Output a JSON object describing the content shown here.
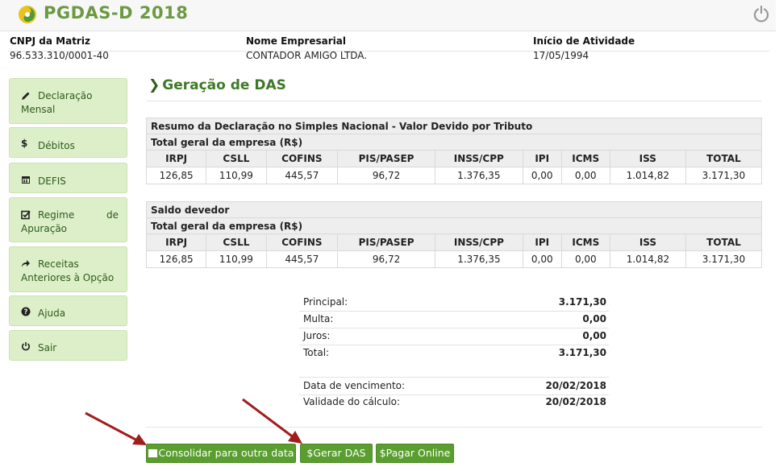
{
  "header": {
    "app_title": "PGDAS-D 2018",
    "logo_icon": "pgdas-logo-icon",
    "power_icon": "power-icon",
    "accent_color": "#6b9a43"
  },
  "company": {
    "cnpj_label": "CNPJ da Matriz",
    "cnpj_value": "96.533.310/0001-40",
    "name_label": "Nome Empresarial",
    "name_value": "CONTADOR AMIGO LTDA.",
    "start_label": "Início de Atividade",
    "start_value": "17/05/1994"
  },
  "sidebar": {
    "items": [
      {
        "icon": "pencil-icon",
        "label_line1": "Declaração",
        "label_line2": "Mensal"
      },
      {
        "icon": "dollar-icon",
        "label": "Débitos"
      },
      {
        "icon": "calendar-icon",
        "label": "DEFIS"
      },
      {
        "icon": "check-square-icon",
        "label_line1a": "Regime",
        "label_line1b": "de",
        "label_line2": "Apuração"
      },
      {
        "icon": "share-arrow-icon",
        "label_line1": "Receitas",
        "label_line2": "Anteriores à Opção"
      },
      {
        "icon": "question-icon",
        "label": "Ajuda"
      },
      {
        "icon": "power-icon",
        "label": "Sair"
      }
    ]
  },
  "main": {
    "title": "Geração de DAS",
    "table1": {
      "caption": "Resumo da Declaração no Simples Nacional - Valor Devido por Tributo",
      "subcaption": "Total geral da empresa (R$)",
      "headers": [
        "IRPJ",
        "CSLL",
        "COFINS",
        "PIS/PASEP",
        "INSS/CPP",
        "IPI",
        "ICMS",
        "ISS",
        "TOTAL"
      ],
      "values": [
        "126,85",
        "110,99",
        "445,57",
        "96,72",
        "1.376,35",
        "0,00",
        "0,00",
        "1.014,82",
        "3.171,30"
      ]
    },
    "table2": {
      "caption": "Saldo devedor",
      "subcaption": "Total geral da empresa (R$)",
      "headers": [
        "IRPJ",
        "CSLL",
        "COFINS",
        "PIS/PASEP",
        "INSS/CPP",
        "IPI",
        "ICMS",
        "ISS",
        "TOTAL"
      ],
      "values": [
        "126,85",
        "110,99",
        "445,57",
        "96,72",
        "1.376,35",
        "0,00",
        "0,00",
        "1.014,82",
        "3.171,30"
      ]
    },
    "summary": [
      {
        "label": "Principal:",
        "value": "3.171,30"
      },
      {
        "label": "Multa:",
        "value": "0,00"
      },
      {
        "label": "Juros:",
        "value": "0,00"
      },
      {
        "label": "Total:",
        "value": "3.171,30"
      }
    ],
    "dates": [
      {
        "label": "Data de vencimento:",
        "value": "20/02/2018"
      },
      {
        "label": "Validade do cálculo:",
        "value": "20/02/2018"
      }
    ]
  },
  "buttons": {
    "consolidar": "Consolidar para outra data",
    "gerar": "Gerar DAS",
    "pagar": "Pagar Online",
    "button_color": "#5a9e2f",
    "annotation_arrow_color": "#a11d1d"
  }
}
